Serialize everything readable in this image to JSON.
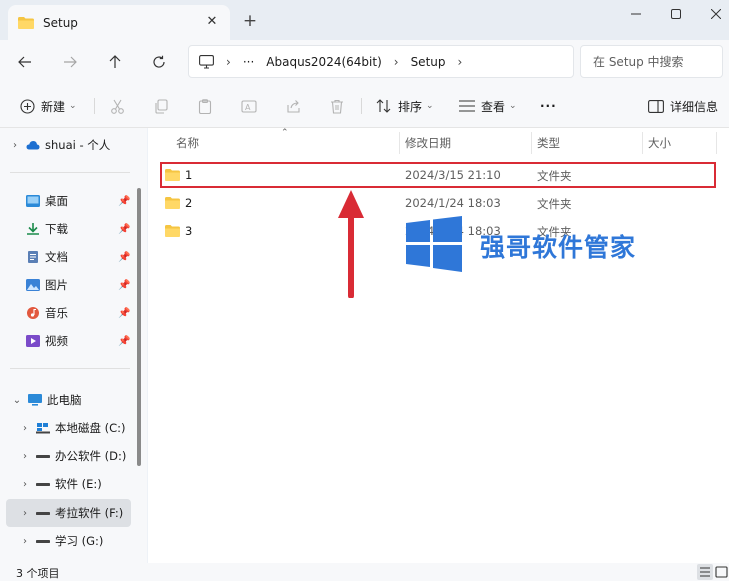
{
  "window": {
    "tab_title": "Setup",
    "tab_close": "✕",
    "new_tab": "+",
    "controls": [
      "minimize-icon",
      "maximize-icon",
      "close-icon"
    ]
  },
  "address_bar": {
    "more": "···",
    "breadcrumb": [
      "Abaqus2024(64bit)",
      "Setup"
    ],
    "separator": "›",
    "search_placeholder": "在 Setup 中搜索"
  },
  "toolbar": {
    "new_label": "新建",
    "sort_label": "排序",
    "view_label": "查看",
    "more_label": "···",
    "details_label": "详细信息",
    "caret": "⌄"
  },
  "sidebar": {
    "cloud": {
      "label": "shuai - 个人"
    },
    "quick_access": [
      {
        "label": "桌面",
        "icon": "desktop-icon"
      },
      {
        "label": "下载",
        "icon": "download-icon"
      },
      {
        "label": "文档",
        "icon": "document-icon"
      },
      {
        "label": "图片",
        "icon": "picture-icon"
      },
      {
        "label": "音乐",
        "icon": "music-icon"
      },
      {
        "label": "视频",
        "icon": "video-icon"
      }
    ],
    "this_pc": {
      "label": "此电脑"
    },
    "drives": [
      {
        "label": "本地磁盘 (C:)"
      },
      {
        "label": "办公软件 (D:)"
      },
      {
        "label": "软件 (E:)"
      },
      {
        "label": "考拉软件 (F:)",
        "selected": true
      },
      {
        "label": "学习 (G:)"
      }
    ]
  },
  "file_list": {
    "columns": [
      "名称",
      "修改日期",
      "类型",
      "大小"
    ],
    "rows": [
      {
        "name": "1",
        "modified": "2024/3/15 21:10",
        "type": "文件夹"
      },
      {
        "name": "2",
        "modified": "2024/1/24 18:03",
        "type": "文件夹"
      },
      {
        "name": "3",
        "modified": "2024/1/24 18:03",
        "type": "文件夹"
      }
    ],
    "highlighted_row": 0
  },
  "watermark": {
    "text": "强哥软件管家"
  },
  "status_bar": {
    "item_count": "3 个项目"
  },
  "colors": {
    "accent": "#2f77d8",
    "highlight_border": "#d92b35",
    "folder": "#f5c542"
  }
}
